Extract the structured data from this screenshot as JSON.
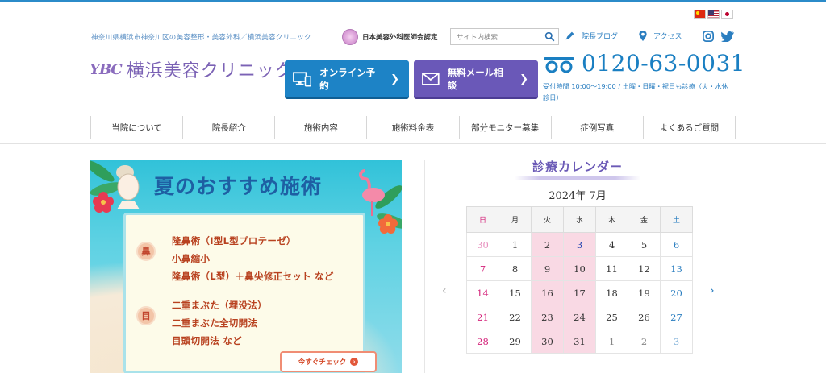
{
  "header": {
    "tagline": "神奈川県横浜市神奈川区の美容整形・美容外科／横浜美容クリニック",
    "association": "日本美容外科医師会認定",
    "search_placeholder": "サイト内検索",
    "blog_label": "院長ブログ",
    "access_label": "アクセス",
    "logo_mark": "YBC",
    "logo_name": "横浜美容クリニック",
    "online_button": "オンライン予約",
    "mail_button": "無料メール相談",
    "phone": "0120-63-0031",
    "hours": "受付時間 10:00～19:00 / 土曜・日曜・祝日も診療（火・水休診日）",
    "languages": [
      "cn-flag-icon",
      "us-flag-icon",
      "jp-flag-icon"
    ]
  },
  "nav": [
    "当院について",
    "院長紹介",
    "施術内容",
    "施術料金表",
    "部分モニター募集",
    "症例写真",
    "よくあるご質問"
  ],
  "banner": {
    "title": "夏のおすすめ施術",
    "categories": [
      {
        "badge": "鼻",
        "items": [
          "隆鼻術（I型L型プロテーゼ）",
          "小鼻縮小",
          "隆鼻術（L型）＋鼻尖修正セット など"
        ]
      },
      {
        "badge": "目",
        "items": [
          "二重まぶた（埋没法）",
          "二重まぶた全切開法",
          "目頭切開法 など"
        ]
      }
    ],
    "cta": "今すぐチェック"
  },
  "calendar": {
    "title": "診療カレンダー",
    "month": "2024年 7月",
    "weekdays": [
      "日",
      "月",
      "火",
      "水",
      "木",
      "金",
      "土"
    ],
    "weeks": [
      [
        "30",
        "1",
        "2",
        "3",
        "4",
        "5",
        "6"
      ],
      [
        "7",
        "8",
        "9",
        "10",
        "11",
        "12",
        "13"
      ],
      [
        "14",
        "15",
        "16",
        "17",
        "18",
        "19",
        "20"
      ],
      [
        "21",
        "22",
        "23",
        "24",
        "25",
        "26",
        "27"
      ],
      [
        "28",
        "29",
        "30",
        "31",
        "1",
        "2",
        "3"
      ]
    ]
  },
  "colors": {
    "accent": "#1d83c6",
    "purple": "#6a58b8",
    "closed": "#f9d9e4"
  }
}
